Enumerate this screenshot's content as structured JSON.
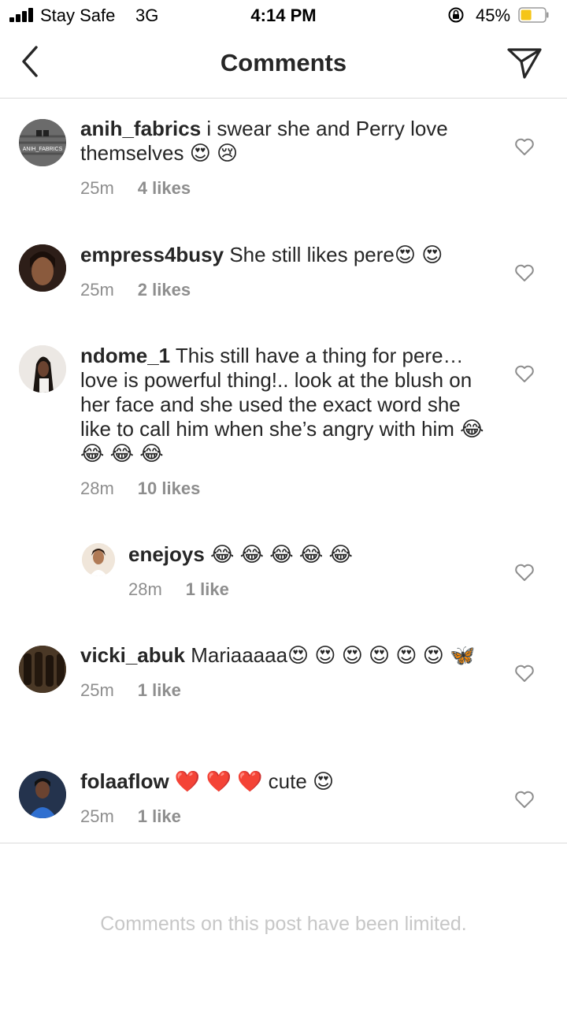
{
  "status_bar": {
    "carrier": "Stay Safe",
    "network": "3G",
    "time": "4:14 PM",
    "battery_percent": "45%",
    "battery_level": 0.45,
    "icons": [
      "signal-bars-icon",
      "orientation-lock-icon",
      "battery-icon"
    ]
  },
  "header": {
    "title": "Comments",
    "back_icon": "chevron-left-icon",
    "share_icon": "paper-plane-icon"
  },
  "comments": [
    {
      "username": "anih_fabrics",
      "text": " i swear she and Perry love themselves 😍 😢",
      "time": "25m",
      "likes": "4 likes",
      "avatar_text": "ANIH_FABRICS"
    },
    {
      "username": "empress4busy",
      "text": " She still likes pere😍 😍",
      "time": "25m",
      "likes": "2 likes"
    },
    {
      "username": "ndome_1",
      "text": " This still have a thing for pere… love is powerful thing!.. look at the blush on her face and she used the exact word she like to call him when she’s angry with him 😂 😂 😂 😂",
      "time": "28m",
      "likes": "10 likes"
    },
    {
      "username": "enejoys",
      "text": " 😂 😂 😂 😂 😂",
      "time": "28m",
      "likes": "1 like",
      "is_reply": true
    },
    {
      "username": "vicki_abuk",
      "text": " Mariaaaaa😍 😍 😍 😍 😍 😍 🦋",
      "time": "25m",
      "likes": "1 like"
    },
    {
      "username": "folaaflow",
      "text": " ❤️ ❤️ ❤️ cute 😍",
      "time": "25m",
      "likes": "1 like"
    }
  ],
  "footer": {
    "limited_notice": "Comments on this post have been limited."
  },
  "colors": {
    "text": "#262626",
    "secondary": "#8e8e8e",
    "divider": "#dbdbdb",
    "notice": "#c7c7c7",
    "battery": "#f5c518"
  }
}
